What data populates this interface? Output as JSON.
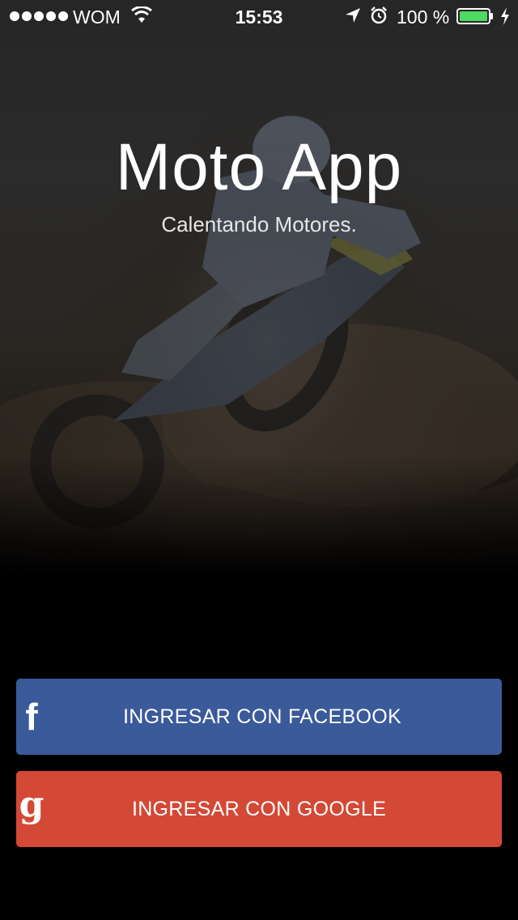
{
  "status_bar": {
    "carrier": "WOM",
    "time": "15:53",
    "battery_percent": "100 %",
    "icons": [
      "signal-dots-icon",
      "wifi-icon",
      "location-arrow-icon",
      "alarm-clock-icon",
      "battery-icon",
      "charging-bolt-icon"
    ]
  },
  "hero": {
    "title": "Moto App",
    "subtitle": "Calentando Motores.",
    "image": "motocross-rider-photo"
  },
  "buttons": {
    "facebook": {
      "icon_glyph": "f",
      "icon": "facebook-f-icon",
      "label": "INGRESAR CON FACEBOOK",
      "color": "#3b5a9a"
    },
    "google": {
      "icon_glyph": "g",
      "icon": "google-g-icon",
      "label": "INGRESAR CON GOOGLE",
      "color": "#d44836"
    }
  },
  "colors": {
    "background": "#000000",
    "battery_fill": "#4cd964"
  }
}
